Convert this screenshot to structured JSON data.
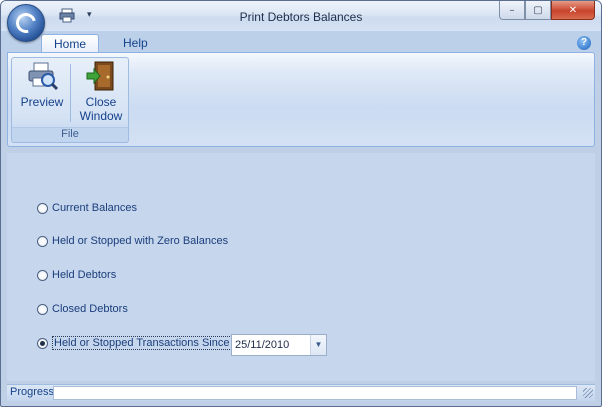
{
  "window": {
    "title": "Print Debtors Balances",
    "quick_access_dropdown": "▾",
    "min_glyph": "–",
    "max_glyph": "▢",
    "close_glyph": "✕"
  },
  "ribbon": {
    "tabs": [
      {
        "label": "Home",
        "active": true
      },
      {
        "label": "Help",
        "active": false
      }
    ],
    "help_glyph": "?",
    "groups": [
      {
        "label": "File",
        "buttons": [
          {
            "label_line1": "Preview",
            "label_line2": "",
            "icon": "printer-preview-icon"
          },
          {
            "label_line1": "Close",
            "label_line2": "Window",
            "icon": "door-exit-icon"
          }
        ]
      }
    ]
  },
  "options": [
    {
      "label": "Current Balances",
      "selected": false
    },
    {
      "label": "Held or Stopped with Zero Balances",
      "selected": false
    },
    {
      "label": "Held Debtors",
      "selected": false
    },
    {
      "label": "Closed Debtors",
      "selected": false
    },
    {
      "label": "Held or Stopped Transactions Since",
      "selected": true
    }
  ],
  "date_field": {
    "value": "25/11/2010",
    "arrow": "▼"
  },
  "status": {
    "label": "Progress"
  },
  "colors": {
    "accent": "#15428b",
    "ribbon": "#d4e1f4",
    "background": "#c6d6ec"
  }
}
